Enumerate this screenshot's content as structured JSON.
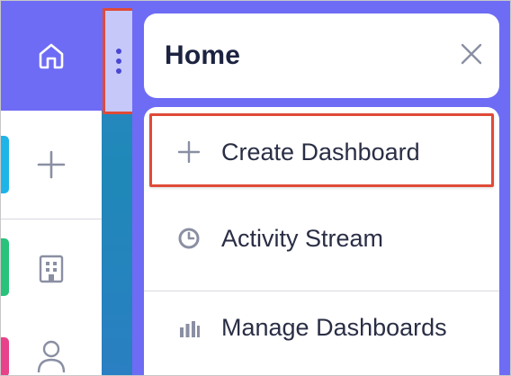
{
  "panel": {
    "title": "Home",
    "close_label": "Close"
  },
  "menu": {
    "items": [
      {
        "label": "Create Dashboard",
        "icon": "plus-icon"
      },
      {
        "label": "Activity Stream",
        "icon": "clock-icon"
      },
      {
        "label": "Manage Dashboards",
        "icon": "bar-chart-icon"
      }
    ]
  },
  "rail": {
    "items": [
      {
        "icon": "home-icon"
      },
      {
        "icon": "plus-icon"
      },
      {
        "icon": "building-icon"
      },
      {
        "icon": "user-icon"
      }
    ]
  },
  "colors": {
    "accent": "#6e6cf5",
    "highlight": "#e04a38",
    "accent_cyan": "#1fb4e8",
    "accent_green": "#28c27a",
    "accent_pink": "#e8428a"
  }
}
